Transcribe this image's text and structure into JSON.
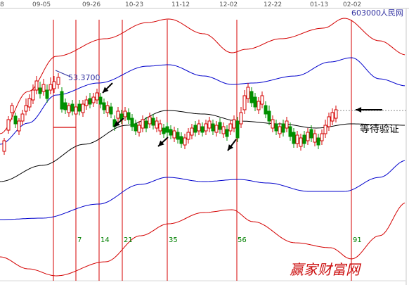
{
  "header": {
    "dates": [
      "8",
      "09-05",
      "09-26",
      "10-23",
      "11-12",
      "12-02",
      "12-22",
      "01-13",
      "02-02"
    ],
    "stock_code": "603000",
    "stock_name": "人民网"
  },
  "price_label": "53.3700",
  "annotation": "等待验证",
  "counts": [
    "7",
    "14",
    "21",
    "35",
    "56",
    "91"
  ],
  "watermark": "赢家财富网",
  "colors": {
    "up": "#d40000",
    "down": "#009000",
    "boll_outer": "#d40000",
    "boll_inner": "#0000cc",
    "middle": "#000000",
    "time_lines": "#d40000"
  },
  "chart_data": {
    "type": "candlestick",
    "period_markers": [
      7,
      14,
      21,
      35,
      56,
      91
    ],
    "price_marker": 53.37
  }
}
